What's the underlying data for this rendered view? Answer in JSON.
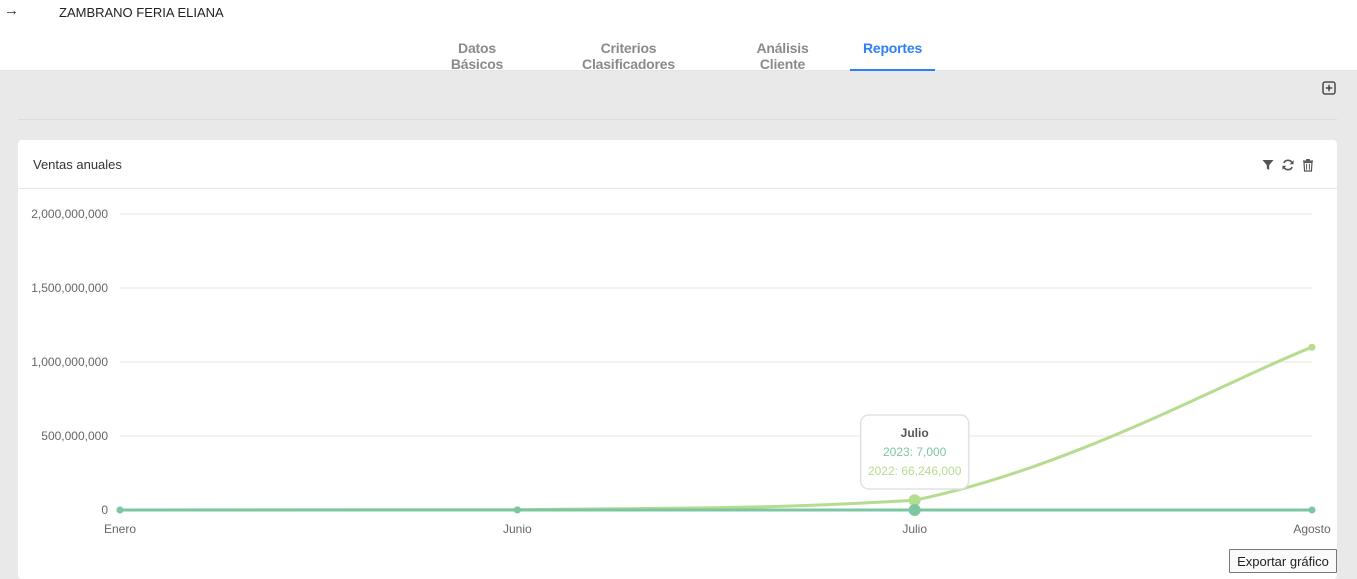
{
  "header": {
    "back_icon": "arrow-right-icon",
    "client_name": "ZAMBRANO FERIA ELIANA"
  },
  "tabs": [
    {
      "label": "Datos Básicos",
      "active": false
    },
    {
      "label": "Criterios Clasificadores",
      "active": false
    },
    {
      "label": "Análisis Cliente",
      "active": false
    },
    {
      "label": "Reportes",
      "active": true
    }
  ],
  "toolbar": {
    "add_icon": "plus-square-icon"
  },
  "card": {
    "title": "Ventas anuales",
    "tools": [
      "filter-icon",
      "refresh-icon",
      "trash-icon"
    ]
  },
  "chart_data": {
    "type": "line",
    "title": "Ventas anuales",
    "categories": [
      "Enero",
      "Junio",
      "Julio",
      "Agosto"
    ],
    "y_ticks": [
      "0",
      "500,000,000",
      "1,000,000,000",
      "1,500,000,000",
      "2,000,000,000"
    ],
    "ylim": [
      0,
      2000000000
    ],
    "grid": true,
    "series": [
      {
        "name": "2023",
        "color": "#7cc7a1",
        "values": [
          0,
          7000,
          7000,
          0
        ]
      },
      {
        "name": "2022",
        "color": "#b5dc8f",
        "values": [
          0,
          2000000,
          66246000,
          1100000000
        ]
      }
    ],
    "tooltip": {
      "title": "Julio",
      "lines": [
        {
          "text": "2023: 7,000",
          "color": "#7cc7a1"
        },
        {
          "text": "2022: 66,246,000",
          "color": "#b5dc8f"
        }
      ]
    }
  },
  "export_button": "Exportar gráfico"
}
